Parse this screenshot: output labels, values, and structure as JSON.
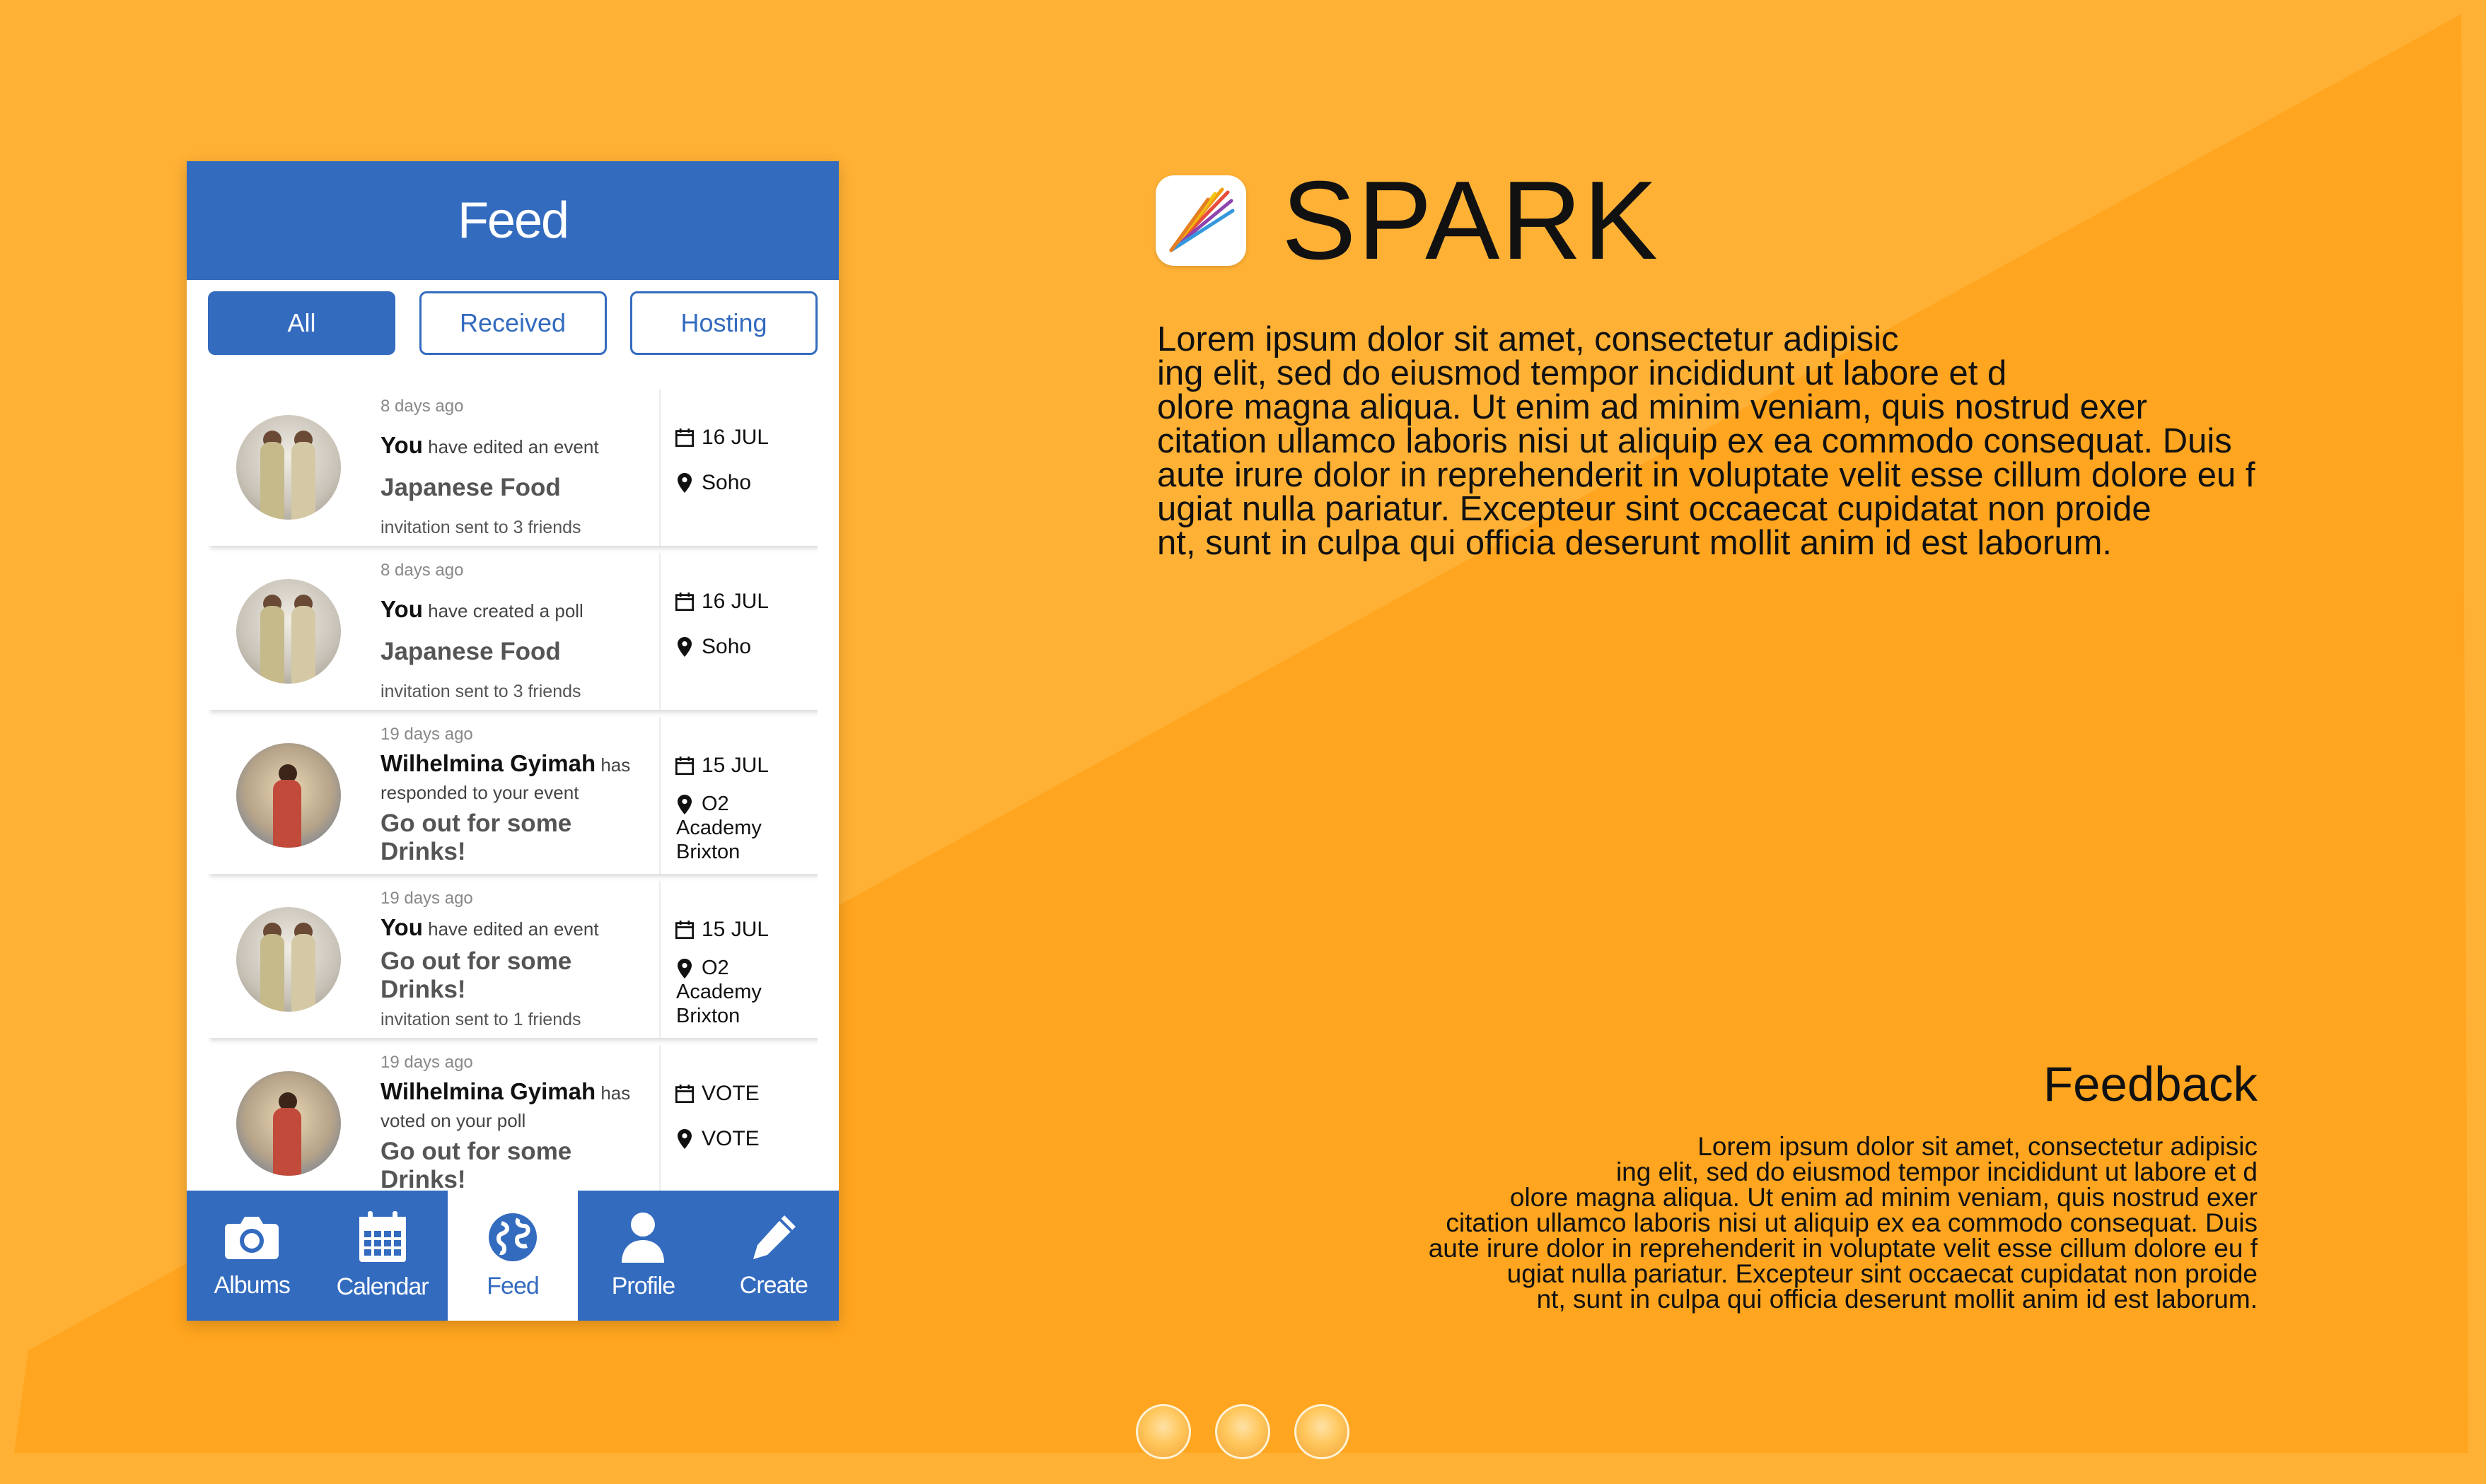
{
  "app": {
    "name": "SPARK",
    "description": "Lorem ipsum dolor sit amet, consectetur adipisic\ning elit, sed do eiusmod tempor incididunt ut labore et d\nolore magna aliqua. Ut enim ad minim veniam, quis nostrud exer\ncitation ullamco laboris nisi ut aliquip ex ea commodo consequat. Duis\n aute irure dolor in reprehenderit in voluptate velit esse cillum dolore eu f\nugiat nulla pariatur. Excepteur sint occaecat cupidatat non proide\nnt, sunt in culpa qui officia deserunt mollit anim id est laborum."
  },
  "feedback": {
    "title": "Feedback",
    "text": "Lorem ipsum dolor sit amet, consectetur adipisic\ning elit, sed do eiusmod tempor incididunt ut labore et d\nolore magna aliqua. Ut enim ad minim veniam, quis nostrud exer\ncitation ullamco laboris nisi ut aliquip ex ea commodo consequat. Duis\naute irure dolor in reprehenderit in voluptate velit esse cillum dolore eu f\nugiat nulla pariatur. Excepteur sint occaecat cupidatat non proide\nnt, sunt in culpa qui officia deserunt mollit anim id est laborum."
  },
  "phone": {
    "header_title": "Feed",
    "tabs": [
      {
        "label": "All"
      },
      {
        "label": "Received"
      },
      {
        "label": "Hosting"
      }
    ],
    "feed": [
      {
        "ago": "8 days ago",
        "who": "You",
        "action": "have edited an event",
        "event": "Japanese Food",
        "note": "invitation sent to 3 friends",
        "date": "16 JUL",
        "location": "Soho"
      },
      {
        "ago": "8 days ago",
        "who": "You",
        "action": "have created a poll",
        "event": "Japanese Food",
        "note": "invitation sent to 3 friends",
        "date": "16 JUL",
        "location": "Soho"
      },
      {
        "ago": "19 days ago",
        "who": "Wilhelmina Gyimah",
        "action": "has",
        "action2": "responded to your event",
        "event": "Go out for some Drinks!",
        "date": "15 JUL",
        "location_lines": [
          "O2",
          "Academy",
          "Brixton"
        ]
      },
      {
        "ago": "19 days ago",
        "who": "You",
        "action": "have edited an event",
        "event": "Go out for some Drinks!",
        "note": "invitation sent to 1 friends",
        "date": "15 JUL",
        "location_lines": [
          "O2",
          "Academy",
          "Brixton"
        ]
      },
      {
        "ago": "19 days ago",
        "who": "Wilhelmina Gyimah",
        "action": "has",
        "action2": "voted on your poll",
        "event": "Go out for some Drinks!",
        "date": "VOTE",
        "location": "VOTE"
      }
    ],
    "nav": [
      {
        "label": "Albums",
        "icon": "camera-icon"
      },
      {
        "label": "Calendar",
        "icon": "calendar-icon"
      },
      {
        "label": "Feed",
        "icon": "globe-icon"
      },
      {
        "label": "Profile",
        "icon": "user-icon"
      },
      {
        "label": "Create",
        "icon": "pencil-icon"
      }
    ]
  },
  "colors": {
    "background": "#ffb136",
    "phone_primary": "#336bbf"
  }
}
